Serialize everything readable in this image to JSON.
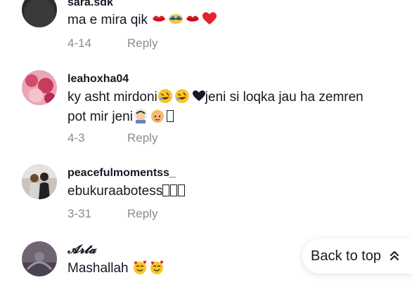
{
  "comments": [
    {
      "username": "sara.sdk",
      "text": "ma e mira qik",
      "emojis": [
        "kiss-lips",
        "swirl-eyes",
        "kiss-lips",
        "red-heart"
      ],
      "date": "4-14",
      "reply_label": "Reply"
    },
    {
      "username": "leahoxha04",
      "text_line1_a": "ky asht mirdoni",
      "text_line1_b": "jeni si loqka jau ha zemren",
      "text_line2": "pot mir jeni",
      "emojis": [
        "rolling-laughing",
        "rolling-laughing",
        "black-heart",
        "bride-with-veil",
        "person-blond",
        "missing-glyph"
      ],
      "date": "4-3",
      "reply_label": "Reply"
    },
    {
      "username": "peacefulmomentss_",
      "text": "ebukuraabotess",
      "emojis": [
        "missing-glyph",
        "missing-glyph",
        "missing-glyph"
      ],
      "date": "3-31",
      "reply_label": "Reply"
    },
    {
      "username": "𝓐𝓻𝓽𝓪",
      "text": "Mashallah",
      "emojis": [
        "smiling-hearts",
        "smiling-hearts"
      ]
    }
  ],
  "back_to_top": {
    "label": "Back to top",
    "icon": "double-chevron-up-icon"
  }
}
